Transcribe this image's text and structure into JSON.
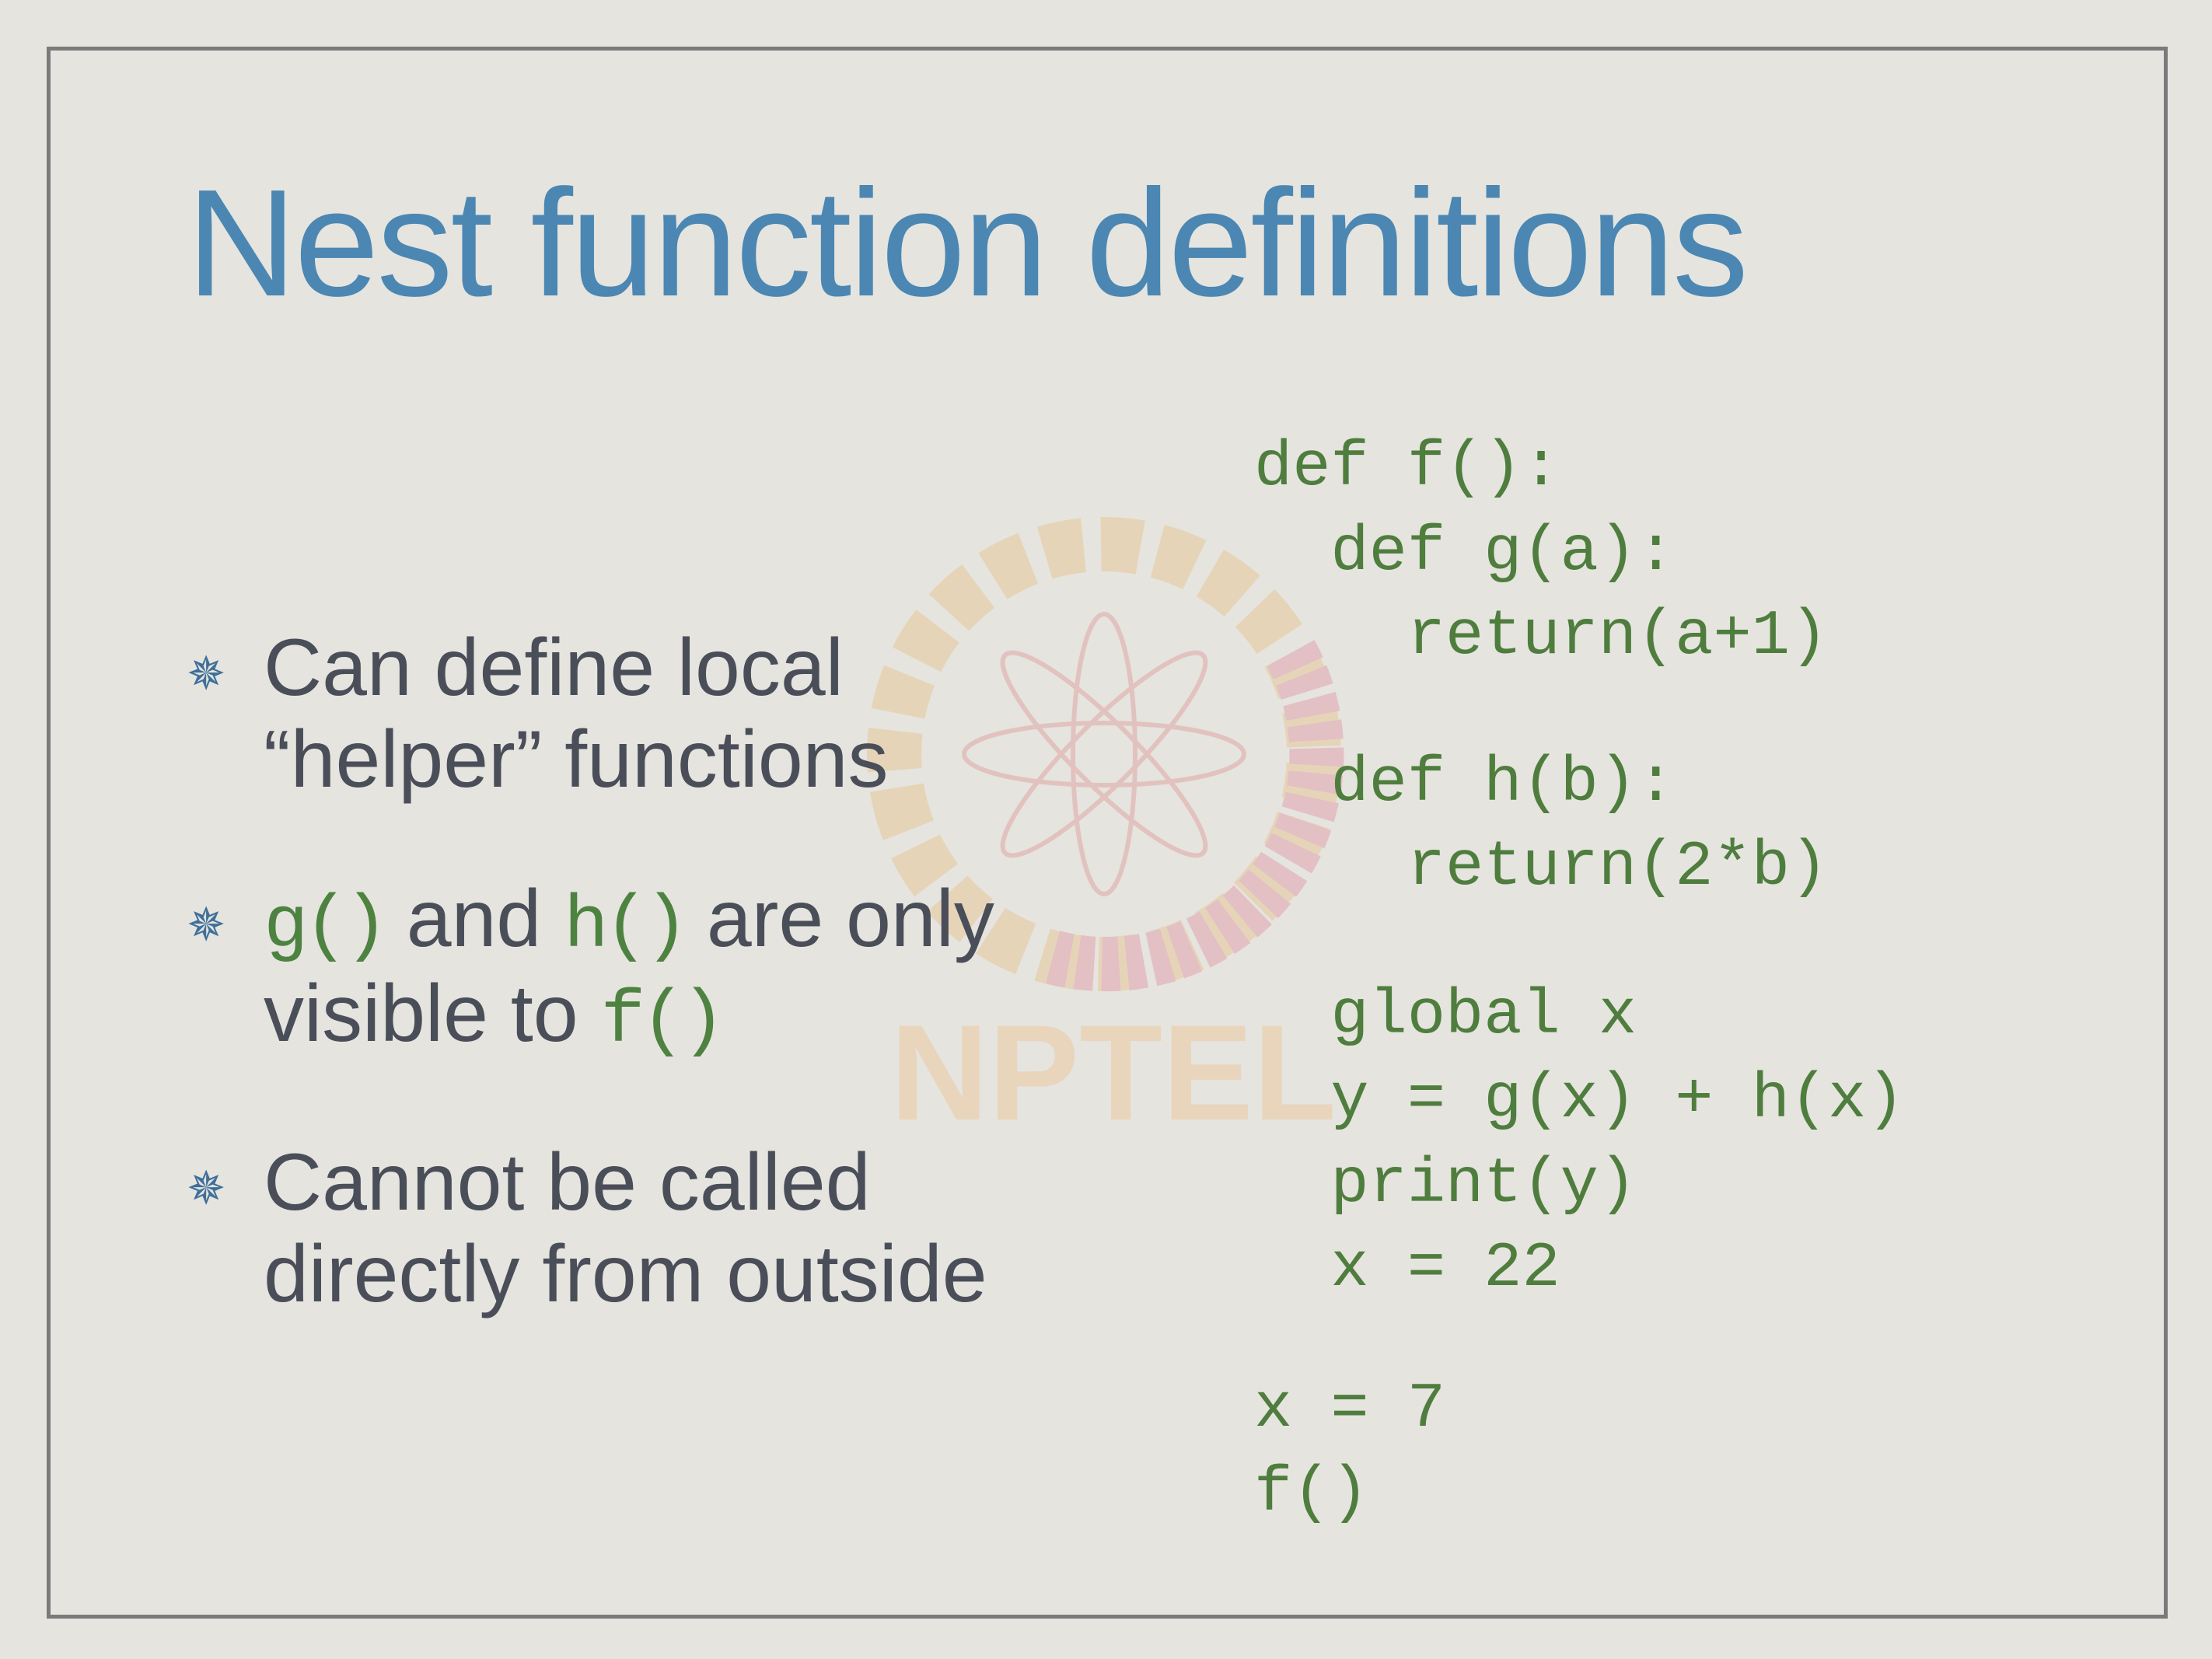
{
  "slide": {
    "title": "Nest function definitions",
    "bullets": [
      {
        "lines": [
          "Can define local",
          "“helper” functions"
        ]
      },
      {
        "parts": {
          "g": "g()",
          "and": " and ",
          "h": "h()",
          "rest": " are only",
          "line2": "visible to ",
          "f": "f()"
        }
      },
      {
        "lines": [
          "Cannot be called",
          "directly from outside"
        ]
      }
    ],
    "bullet_icon": "asterisk-bullet-icon",
    "code_lines": [
      "def f():",
      "  def g(a):",
      "    return(a+1)",
      "",
      "  def h(b):",
      "    return(2*b)",
      "",
      "  global x",
      "  y = g(x) + h(x)",
      "  print(y)",
      "  x = 22",
      "",
      "x = 7",
      "f()"
    ],
    "watermark_text": "NPTEL"
  },
  "colors": {
    "title": "#4b87b2",
    "text": "#4a4e59",
    "code": "#4f7d3e",
    "background": "#e5e4df"
  }
}
